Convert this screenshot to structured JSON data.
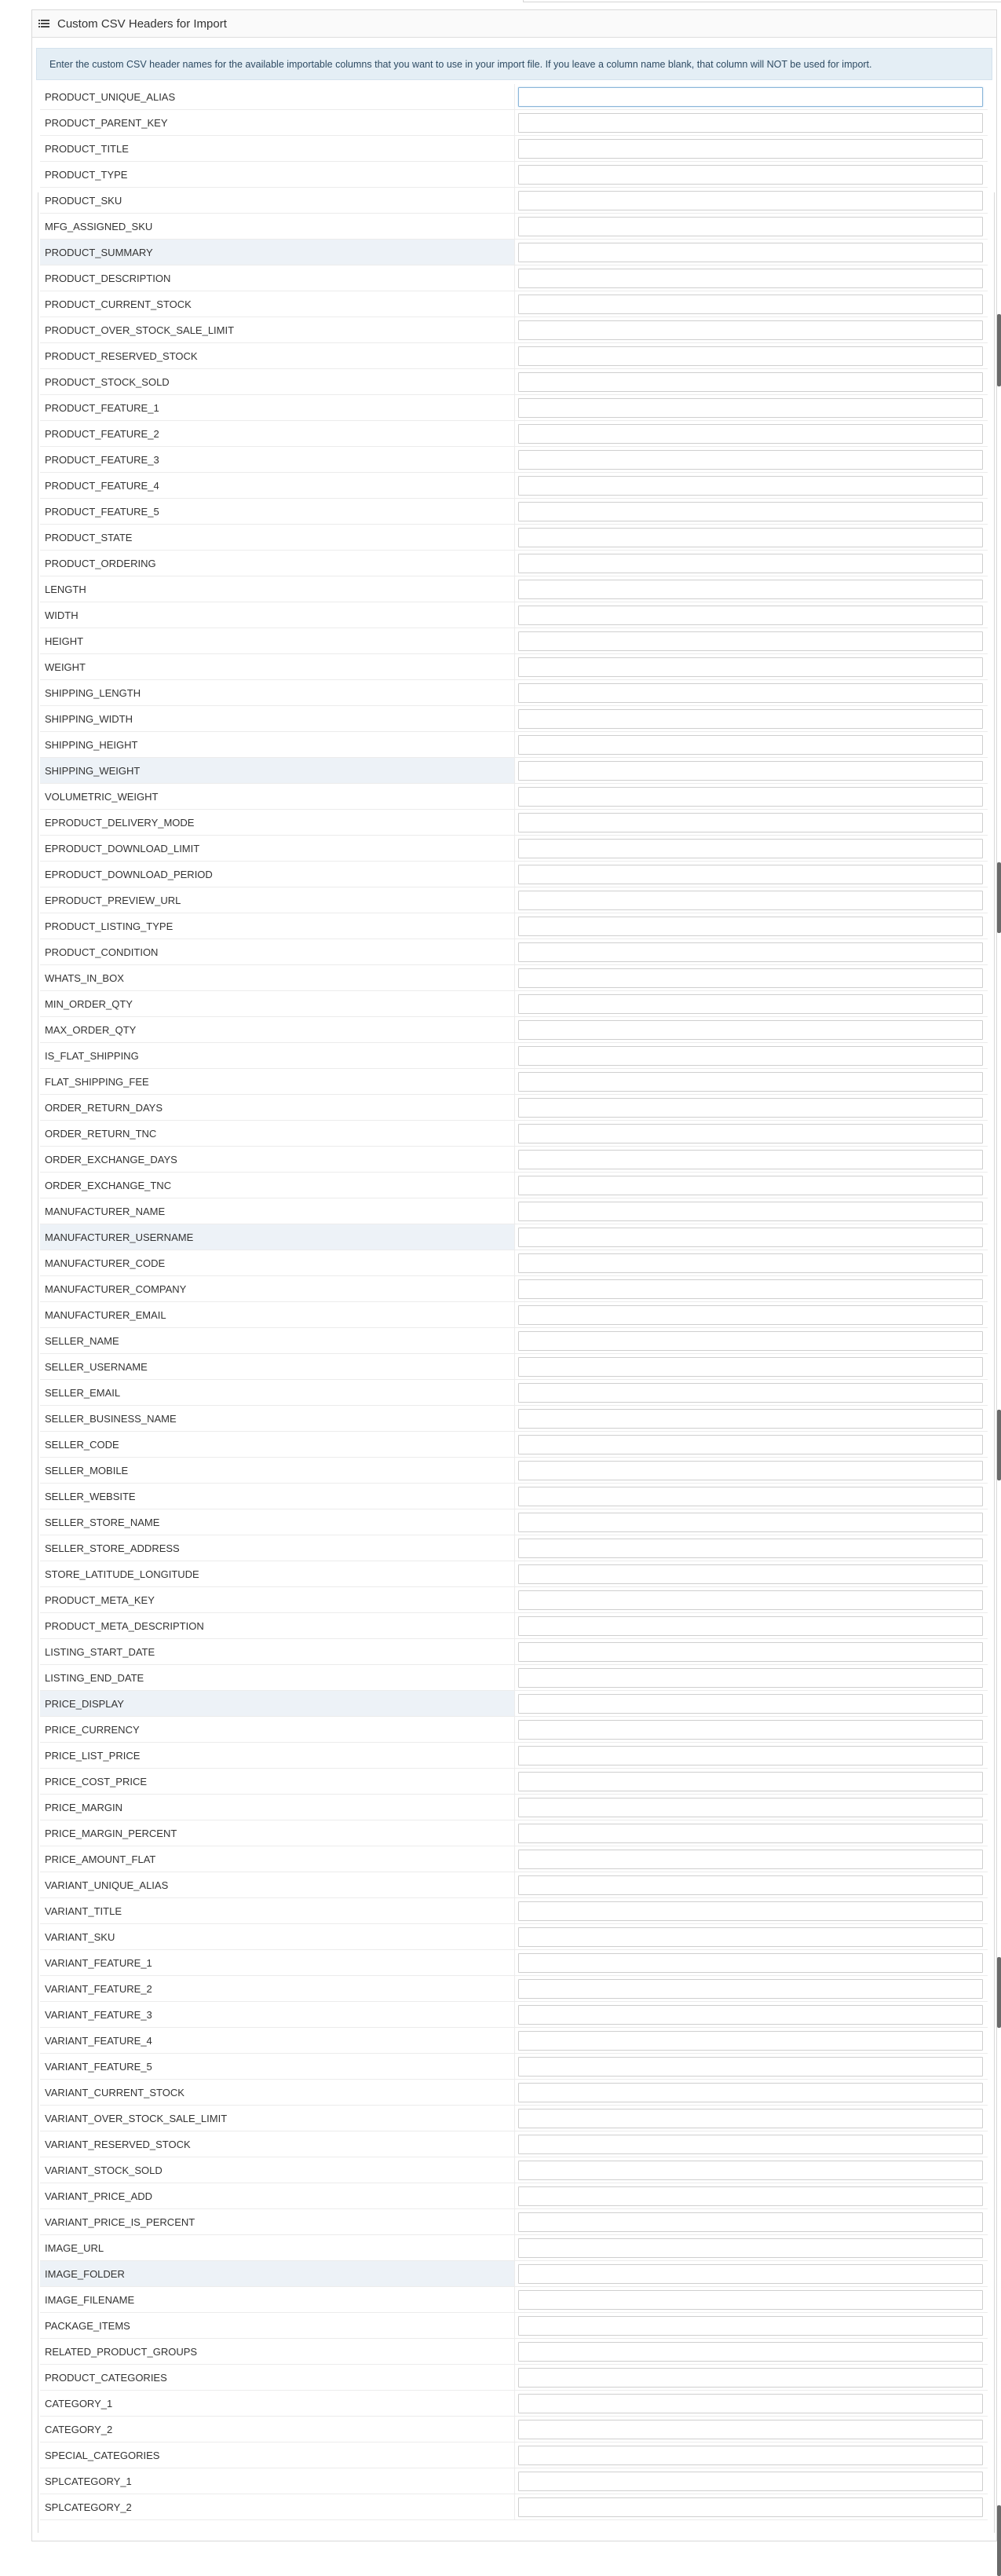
{
  "panel": {
    "title": "Custom CSV Headers for Import",
    "header_icon": "list-icon",
    "note": "Enter the custom CSV header names for the available importable columns that you want to use in your import file. If you leave a column name blank, that column will NOT be used for import."
  },
  "highlighted_rows": [
    "PRODUCT_SUMMARY",
    "SHIPPING_WEIGHT",
    "MANUFACTURER_USERNAME",
    "PRICE_DISPLAY",
    "IMAGE_FOLDER"
  ],
  "focused_row": "PRODUCT_UNIQUE_ALIAS",
  "columns": [
    {
      "label": "PRODUCT_UNIQUE_ALIAS",
      "value": ""
    },
    {
      "label": "PRODUCT_PARENT_KEY",
      "value": ""
    },
    {
      "label": "PRODUCT_TITLE",
      "value": ""
    },
    {
      "label": "PRODUCT_TYPE",
      "value": ""
    },
    {
      "label": "PRODUCT_SKU",
      "value": ""
    },
    {
      "label": "MFG_ASSIGNED_SKU",
      "value": ""
    },
    {
      "label": "PRODUCT_SUMMARY",
      "value": ""
    },
    {
      "label": "PRODUCT_DESCRIPTION",
      "value": ""
    },
    {
      "label": "PRODUCT_CURRENT_STOCK",
      "value": ""
    },
    {
      "label": "PRODUCT_OVER_STOCK_SALE_LIMIT",
      "value": ""
    },
    {
      "label": "PRODUCT_RESERVED_STOCK",
      "value": ""
    },
    {
      "label": "PRODUCT_STOCK_SOLD",
      "value": ""
    },
    {
      "label": "PRODUCT_FEATURE_1",
      "value": ""
    },
    {
      "label": "PRODUCT_FEATURE_2",
      "value": ""
    },
    {
      "label": "PRODUCT_FEATURE_3",
      "value": ""
    },
    {
      "label": "PRODUCT_FEATURE_4",
      "value": ""
    },
    {
      "label": "PRODUCT_FEATURE_5",
      "value": ""
    },
    {
      "label": "PRODUCT_STATE",
      "value": ""
    },
    {
      "label": "PRODUCT_ORDERING",
      "value": ""
    },
    {
      "label": "LENGTH",
      "value": ""
    },
    {
      "label": "WIDTH",
      "value": ""
    },
    {
      "label": "HEIGHT",
      "value": ""
    },
    {
      "label": "WEIGHT",
      "value": ""
    },
    {
      "label": "SHIPPING_LENGTH",
      "value": ""
    },
    {
      "label": "SHIPPING_WIDTH",
      "value": ""
    },
    {
      "label": "SHIPPING_HEIGHT",
      "value": ""
    },
    {
      "label": "SHIPPING_WEIGHT",
      "value": ""
    },
    {
      "label": "VOLUMETRIC_WEIGHT",
      "value": ""
    },
    {
      "label": "EPRODUCT_DELIVERY_MODE",
      "value": ""
    },
    {
      "label": "EPRODUCT_DOWNLOAD_LIMIT",
      "value": ""
    },
    {
      "label": "EPRODUCT_DOWNLOAD_PERIOD",
      "value": ""
    },
    {
      "label": "EPRODUCT_PREVIEW_URL",
      "value": ""
    },
    {
      "label": "PRODUCT_LISTING_TYPE",
      "value": ""
    },
    {
      "label": "PRODUCT_CONDITION",
      "value": ""
    },
    {
      "label": "WHATS_IN_BOX",
      "value": ""
    },
    {
      "label": "MIN_ORDER_QTY",
      "value": ""
    },
    {
      "label": "MAX_ORDER_QTY",
      "value": ""
    },
    {
      "label": "IS_FLAT_SHIPPING",
      "value": ""
    },
    {
      "label": "FLAT_SHIPPING_FEE",
      "value": ""
    },
    {
      "label": "ORDER_RETURN_DAYS",
      "value": ""
    },
    {
      "label": "ORDER_RETURN_TNC",
      "value": ""
    },
    {
      "label": "ORDER_EXCHANGE_DAYS",
      "value": ""
    },
    {
      "label": "ORDER_EXCHANGE_TNC",
      "value": ""
    },
    {
      "label": "MANUFACTURER_NAME",
      "value": ""
    },
    {
      "label": "MANUFACTURER_USERNAME",
      "value": ""
    },
    {
      "label": "MANUFACTURER_CODE",
      "value": ""
    },
    {
      "label": "MANUFACTURER_COMPANY",
      "value": ""
    },
    {
      "label": "MANUFACTURER_EMAIL",
      "value": ""
    },
    {
      "label": "SELLER_NAME",
      "value": ""
    },
    {
      "label": "SELLER_USERNAME",
      "value": ""
    },
    {
      "label": "SELLER_EMAIL",
      "value": ""
    },
    {
      "label": "SELLER_BUSINESS_NAME",
      "value": ""
    },
    {
      "label": "SELLER_CODE",
      "value": ""
    },
    {
      "label": "SELLER_MOBILE",
      "value": ""
    },
    {
      "label": "SELLER_WEBSITE",
      "value": ""
    },
    {
      "label": "SELLER_STORE_NAME",
      "value": ""
    },
    {
      "label": "SELLER_STORE_ADDRESS",
      "value": ""
    },
    {
      "label": "STORE_LATITUDE_LONGITUDE",
      "value": ""
    },
    {
      "label": "PRODUCT_META_KEY",
      "value": ""
    },
    {
      "label": "PRODUCT_META_DESCRIPTION",
      "value": ""
    },
    {
      "label": "LISTING_START_DATE",
      "value": ""
    },
    {
      "label": "LISTING_END_DATE",
      "value": ""
    },
    {
      "label": "PRICE_DISPLAY",
      "value": ""
    },
    {
      "label": "PRICE_CURRENCY",
      "value": ""
    },
    {
      "label": "PRICE_LIST_PRICE",
      "value": ""
    },
    {
      "label": "PRICE_COST_PRICE",
      "value": ""
    },
    {
      "label": "PRICE_MARGIN",
      "value": ""
    },
    {
      "label": "PRICE_MARGIN_PERCENT",
      "value": ""
    },
    {
      "label": "PRICE_AMOUNT_FLAT",
      "value": ""
    },
    {
      "label": "VARIANT_UNIQUE_ALIAS",
      "value": ""
    },
    {
      "label": "VARIANT_TITLE",
      "value": ""
    },
    {
      "label": "VARIANT_SKU",
      "value": ""
    },
    {
      "label": "VARIANT_FEATURE_1",
      "value": ""
    },
    {
      "label": "VARIANT_FEATURE_2",
      "value": ""
    },
    {
      "label": "VARIANT_FEATURE_3",
      "value": ""
    },
    {
      "label": "VARIANT_FEATURE_4",
      "value": ""
    },
    {
      "label": "VARIANT_FEATURE_5",
      "value": ""
    },
    {
      "label": "VARIANT_CURRENT_STOCK",
      "value": ""
    },
    {
      "label": "VARIANT_OVER_STOCK_SALE_LIMIT",
      "value": ""
    },
    {
      "label": "VARIANT_RESERVED_STOCK",
      "value": ""
    },
    {
      "label": "VARIANT_STOCK_SOLD",
      "value": ""
    },
    {
      "label": "VARIANT_PRICE_ADD",
      "value": ""
    },
    {
      "label": "VARIANT_PRICE_IS_PERCENT",
      "value": ""
    },
    {
      "label": "IMAGE_URL",
      "value": ""
    },
    {
      "label": "IMAGE_FOLDER",
      "value": ""
    },
    {
      "label": "IMAGE_FILENAME",
      "value": ""
    },
    {
      "label": "PACKAGE_ITEMS",
      "value": ""
    },
    {
      "label": "RELATED_PRODUCT_GROUPS",
      "value": ""
    },
    {
      "label": "PRODUCT_CATEGORIES",
      "value": ""
    },
    {
      "label": "CATEGORY_1",
      "value": ""
    },
    {
      "label": "CATEGORY_2",
      "value": ""
    },
    {
      "label": "SPECIAL_CATEGORIES",
      "value": ""
    },
    {
      "label": "SPLCATEGORY_1",
      "value": ""
    },
    {
      "label": "SPLCATEGORY_2",
      "value": ""
    }
  ]
}
